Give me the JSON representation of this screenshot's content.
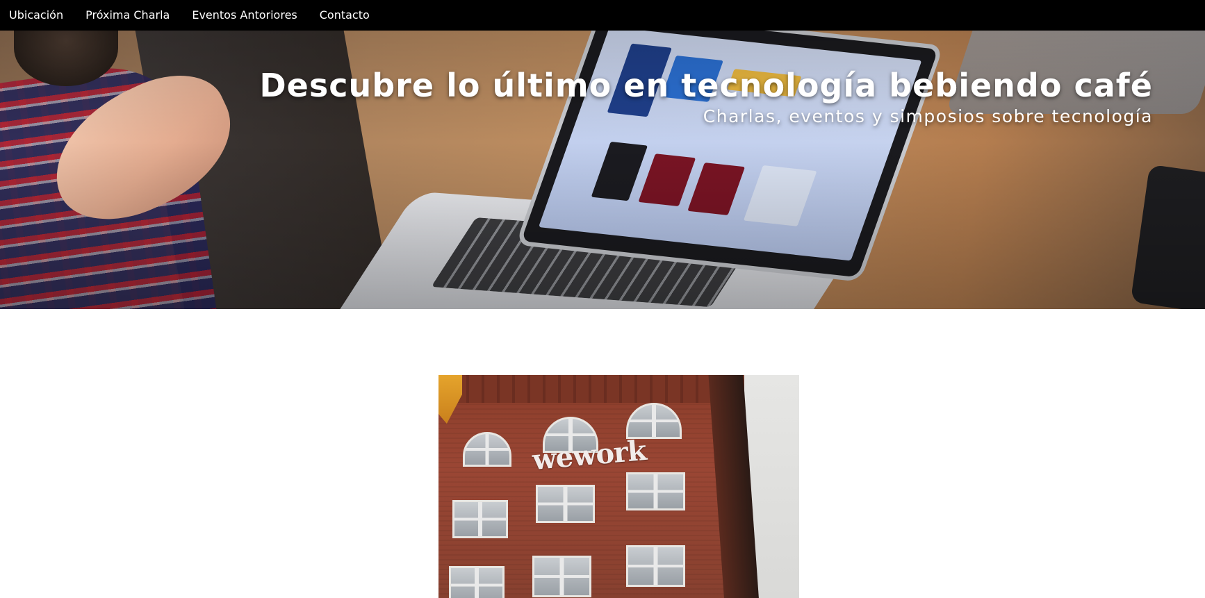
{
  "nav": {
    "items": [
      {
        "label": "Ubicación"
      },
      {
        "label": "Próxima Charla"
      },
      {
        "label": "Eventos Antoriores"
      },
      {
        "label": "Contacto"
      }
    ]
  },
  "hero": {
    "title": "Descubre lo último en tecnología bebiendo café",
    "subtitle": "Charlas, eventos y simposios sobre tecnología",
    "image_icon": "laptop-meeting-photo"
  },
  "venue": {
    "image_icon": "wework-building-photo",
    "sign_text": "wework"
  },
  "colors": {
    "navbar_bg": "#000000",
    "nav_text": "#ffffff",
    "hero_text": "#ffffff",
    "page_bg": "#ffffff"
  }
}
